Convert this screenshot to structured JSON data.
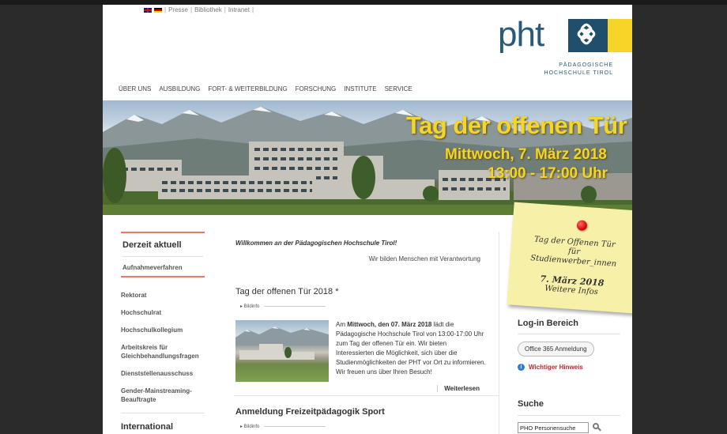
{
  "toplinks": {
    "presse": "Presse",
    "bibliothek": "Bibliothek",
    "intranet": "Intranet",
    "sep": "|"
  },
  "logo": {
    "text": "pht",
    "subtitle_line1": "PÄDAGOGISCHE",
    "subtitle_line2": "HOCHSCHULE TIROL",
    "colors": {
      "blue": "#1f4f6a",
      "yellow": "#f6d428"
    }
  },
  "nav": [
    "ÜBER UNS",
    "AUSBILDUNG",
    "FORT- & WEITERBILDUNG",
    "FORSCHUNG",
    "INSTITUTE",
    "SERVICE"
  ],
  "banner": {
    "title": "Tag der offenen Tür",
    "date": "Mittwoch, 7. März 2018",
    "time": "13:00 - 17:00 Uhr"
  },
  "sidebar": {
    "box_title": "Derzeit aktuell",
    "box_sub": "Aufnahmeverfahren",
    "items": [
      "Rektorat",
      "Hochschulrat",
      "Hochschulkollegium",
      "Arbeitskreis für Gleichbehandlungsfragen",
      "Dienststellenausschuss",
      "Gender-Mainstreaming-Beauftragte"
    ],
    "international": "International"
  },
  "center": {
    "welcome": "Willkommen an der Pädagogischen Hochschule Tirol!",
    "motto": "Wir bilden Menschen mit Verantwortung",
    "article1": {
      "heading": "Tag der offenen Tür 2018 *",
      "bildinfo": "▸ Bildinfo",
      "text_prefix": "Am ",
      "text_bold": "Mittwoch, den 07. März 2018",
      "text_rest": " lädt die Pädagogische Hochschule Tirol von 13:00-17:00 Uhr zum Tag der offenen Tür ein. Wir bieten Interessierten die Möglichkeit, sich über die Studienmöglichkeiten der PHT vor Ort zu informieren. Wir freuen uns über Ihren Besuch!",
      "more": "Weiterlesen"
    },
    "article2": {
      "heading": "Anmeldung Freizeitpädagogik Sport",
      "bildinfo": "▸ Bildinfo"
    }
  },
  "sticky": {
    "line1": "Tag der Offenen Tür",
    "line2": "für",
    "line3": "Studienwerber_innen",
    "line4": "7. März 2018",
    "line5": "Weitere Infos"
  },
  "right": {
    "login_title": "Log-in Bereich",
    "o365": "Office 365 Anmeldung",
    "hint": "Wichtiger Hinweis",
    "info_glyph": "i",
    "search_title": "Suche",
    "search_value": "PHO Personensuche"
  }
}
